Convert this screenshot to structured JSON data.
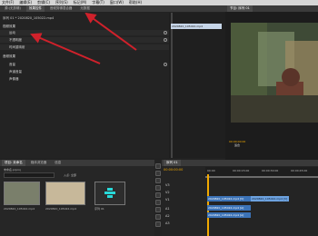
{
  "menubar": {
    "items": [
      "文件(F)",
      "编辑(E)",
      "剪辑(C)",
      "序列(S)",
      "标记(M)",
      "字幕(T)",
      "窗口(W)",
      "帮助(H)"
    ]
  },
  "effect_controls": {
    "tabs": [
      "源:(无剪辑)",
      "效果控件",
      "音频剪辑混合器",
      "元数据"
    ],
    "header": "序列 01 * 2020820_105022.mp4",
    "sections": {
      "video": "视频效果",
      "motion": "运动",
      "opacity": "不透明度",
      "timeremap": "时间重映射",
      "audio": "音频效果",
      "volume": "音量",
      "channel_volume": "声道音量",
      "panner": "声像器"
    },
    "clip_tag": "2020820_105022.mp4",
    "timecode_left": "00:00:00:00"
  },
  "program": {
    "tab": "节目: 序列 01",
    "timecode": "00:00:00:00",
    "fit": "适合"
  },
  "project": {
    "tabs": [
      "项目: 未命名",
      "媒体浏览器",
      "信息"
    ],
    "title": "未命名.prproj",
    "search_placeholder": "",
    "in_label": "入点: 全部",
    "items": [
      {
        "name": "2020820_105022.mp4",
        "dur": "1:04"
      },
      {
        "name": "2020820_105022.mp4",
        "dur": "3:24"
      },
      {
        "name": "序列 01",
        "dur": "1:31"
      }
    ]
  },
  "timeline": {
    "tab": "序列 01",
    "timecode": "00:00:00:00",
    "ruler": [
      "00:00",
      "00:00:15:00",
      "00:00:30:00",
      "00:00:45:00"
    ],
    "tracks": [
      "V3",
      "V2",
      "V1",
      "A1",
      "A2",
      "A3"
    ],
    "clip1": "2020820_105022.mp4 [V]",
    "clip2": "2020820_105022.mp4 [V]",
    "clip3": "2020820_105022.mp4 [A]",
    "clip4": "2020820_105022.mp4 [A]"
  },
  "colors": {
    "arrow": "#d0212b",
    "timeline_clip": "#3c73b7",
    "timeline_clip_light": "#6da2df",
    "playhead": "#f2a900"
  }
}
